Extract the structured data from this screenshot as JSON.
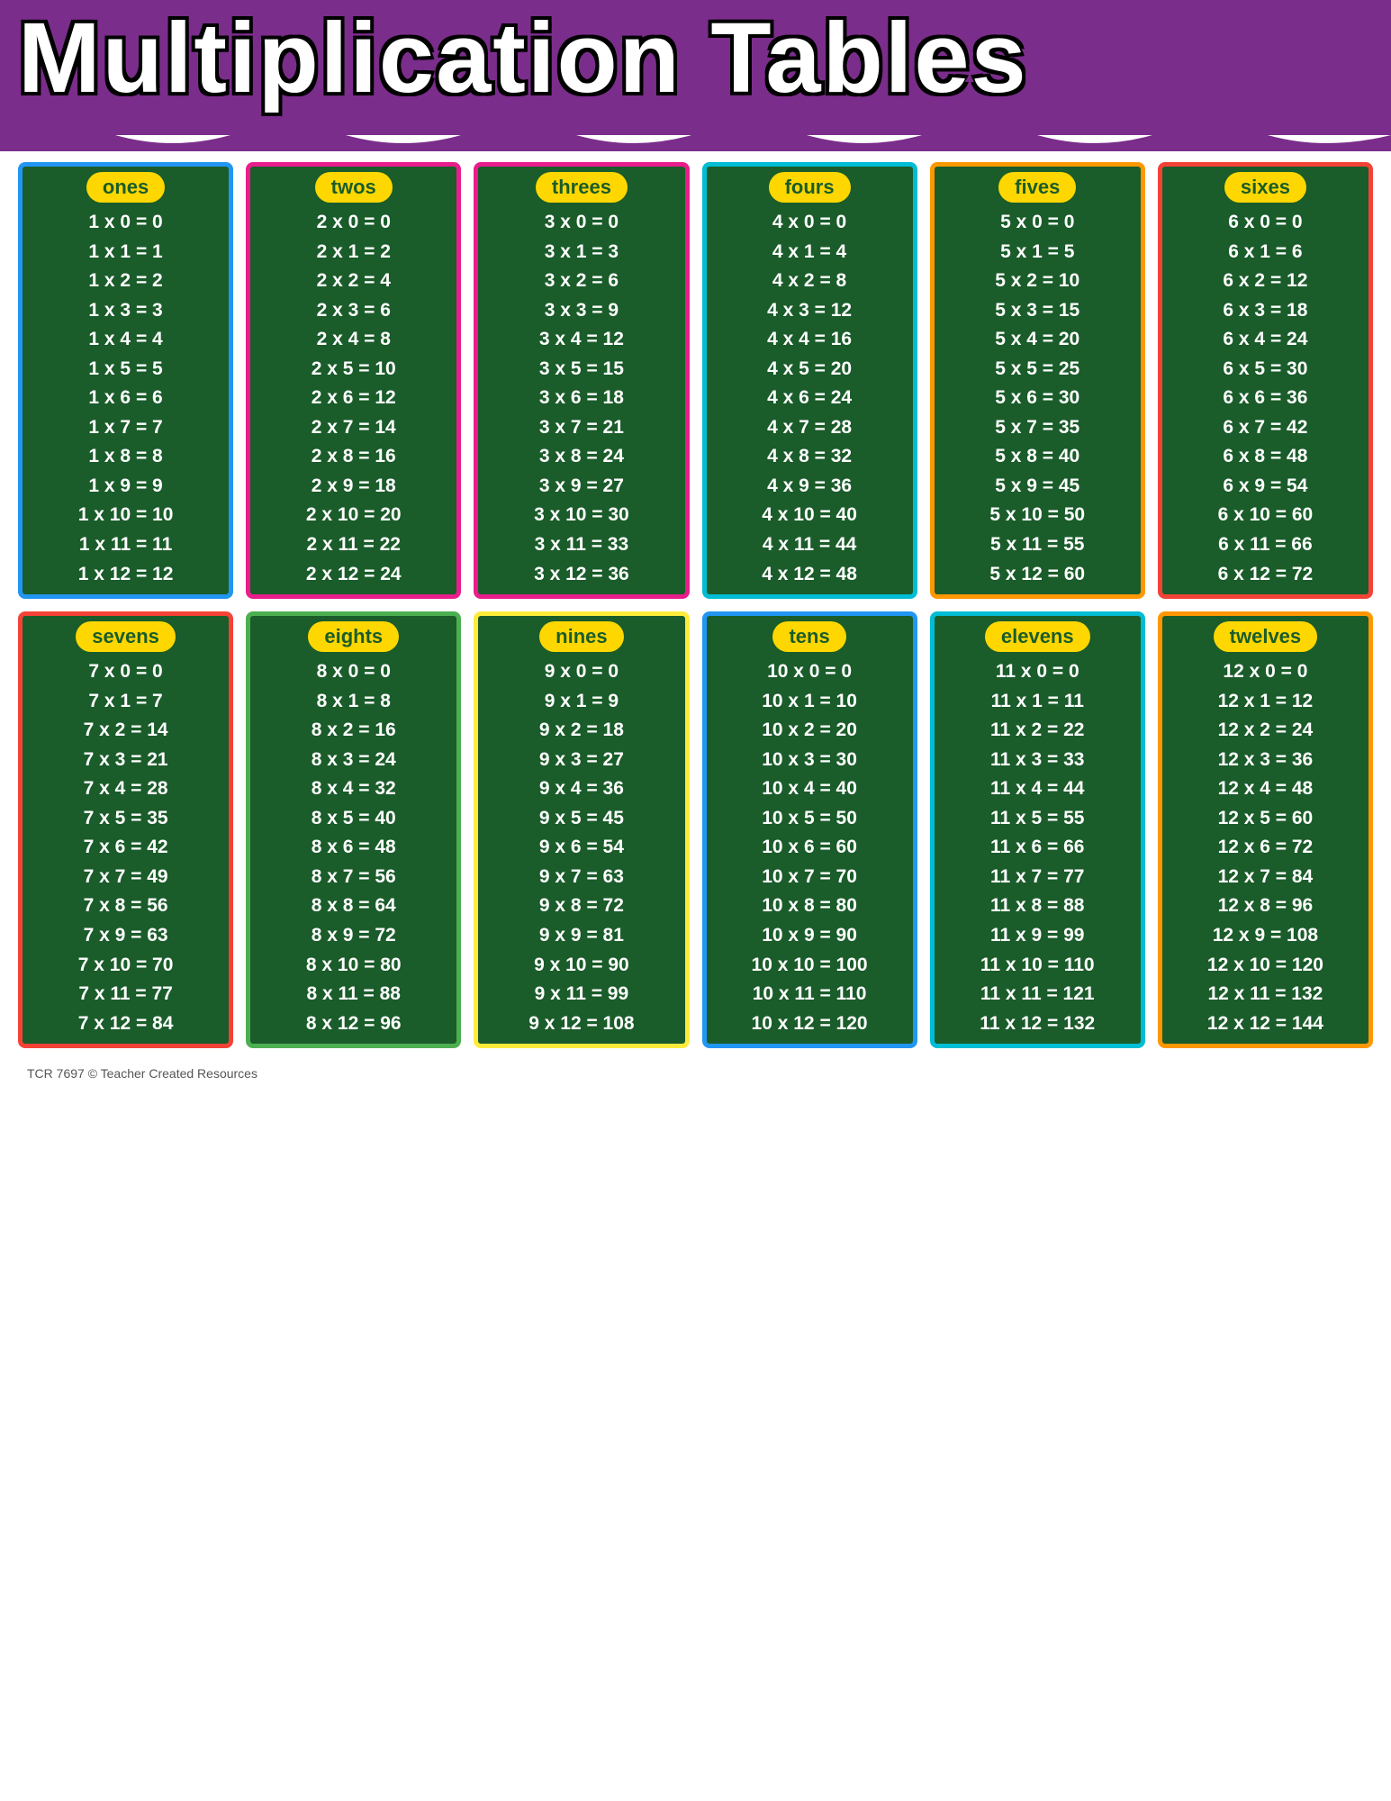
{
  "header": {
    "title": "Multiplication Tables",
    "bg_color": "#7B2D8B"
  },
  "footer": {
    "text": "TCR 7697 © Teacher Created Resources"
  },
  "tables": [
    {
      "id": "ones",
      "label": "ones",
      "border_color": "blue",
      "multiplier": 1,
      "rows": [
        "1 x 0 = 0",
        "1 x 1 = 1",
        "1 x 2 = 2",
        "1 x 3 = 3",
        "1 x 4 = 4",
        "1 x 5 = 5",
        "1 x 6 = 6",
        "1 x 7 = 7",
        "1 x 8 = 8",
        "1 x 9 = 9",
        "1 x 10 = 10",
        "1 x 11 = 11",
        "1 x 12 = 12"
      ]
    },
    {
      "id": "twos",
      "label": "twos",
      "border_color": "pink",
      "multiplier": 2,
      "rows": [
        "2 x 0 = 0",
        "2 x 1 = 2",
        "2 x 2 = 4",
        "2 x 3 = 6",
        "2 x 4 = 8",
        "2 x 5 = 10",
        "2 x 6 = 12",
        "2 x 7 = 14",
        "2 x 8 = 16",
        "2 x 9 = 18",
        "2 x 10 = 20",
        "2 x 11 = 22",
        "2 x 12 = 24"
      ]
    },
    {
      "id": "threes",
      "label": "threes",
      "border_color": "pink",
      "multiplier": 3,
      "rows": [
        "3 x 0 = 0",
        "3 x 1 = 3",
        "3 x 2 = 6",
        "3 x 3 = 9",
        "3 x 4 = 12",
        "3 x 5 = 15",
        "3 x 6 = 18",
        "3 x 7 = 21",
        "3 x 8 = 24",
        "3 x 9 = 27",
        "3 x 10 = 30",
        "3 x 11 = 33",
        "3 x 12 = 36"
      ]
    },
    {
      "id": "fours",
      "label": "fours",
      "border_color": "teal",
      "multiplier": 4,
      "rows": [
        "4 x 0 = 0",
        "4 x 1 = 4",
        "4 x 2 = 8",
        "4 x 3 = 12",
        "4 x 4 = 16",
        "4 x 5 = 20",
        "4 x 6 = 24",
        "4 x 7 = 28",
        "4 x 8 = 32",
        "4 x 9 = 36",
        "4 x 10 = 40",
        "4 x 11 = 44",
        "4 x 12 = 48"
      ]
    },
    {
      "id": "fives",
      "label": "fives",
      "border_color": "orange",
      "multiplier": 5,
      "rows": [
        "5 x 0 = 0",
        "5 x 1 = 5",
        "5 x 2 = 10",
        "5 x 3 = 15",
        "5 x 4 = 20",
        "5 x 5 = 25",
        "5 x 6 = 30",
        "5 x 7 = 35",
        "5 x 8 = 40",
        "5 x 9 = 45",
        "5 x 10 = 50",
        "5 x 11 = 55",
        "5 x 12 = 60"
      ]
    },
    {
      "id": "sixes",
      "label": "sixes",
      "border_color": "red",
      "multiplier": 6,
      "rows": [
        "6 x 0 = 0",
        "6 x 1 = 6",
        "6 x 2 = 12",
        "6 x 3 = 18",
        "6 x 4 = 24",
        "6 x 5 = 30",
        "6 x 6 = 36",
        "6 x 7 = 42",
        "6 x 8 = 48",
        "6 x 9 = 54",
        "6 x 10 = 60",
        "6 x 11 = 66",
        "6 x 12 = 72"
      ]
    },
    {
      "id": "sevens",
      "label": "sevens",
      "border_color": "red",
      "multiplier": 7,
      "rows": [
        "7 x 0 = 0",
        "7 x 1 = 7",
        "7 x 2 = 14",
        "7 x 3 = 21",
        "7 x 4 = 28",
        "7 x 5 = 35",
        "7 x 6 = 42",
        "7 x 7 = 49",
        "7 x 8 = 56",
        "7 x 9 = 63",
        "7 x 10 = 70",
        "7 x 11 = 77",
        "7 x 12 = 84"
      ]
    },
    {
      "id": "eights",
      "label": "eights",
      "border_color": "green",
      "multiplier": 8,
      "rows": [
        "8 x 0 = 0",
        "8 x 1 = 8",
        "8 x 2 = 16",
        "8 x 3 = 24",
        "8 x 4 = 32",
        "8 x 5 = 40",
        "8 x 6 = 48",
        "8 x 7 = 56",
        "8 x 8 = 64",
        "8 x 9 = 72",
        "8 x 10 = 80",
        "8 x 11 = 88",
        "8 x 12 = 96"
      ]
    },
    {
      "id": "nines",
      "label": "nines",
      "border_color": "yellow-border",
      "multiplier": 9,
      "rows": [
        "9 x 0 = 0",
        "9 x 1 = 9",
        "9 x 2 = 18",
        "9 x 3 = 27",
        "9 x 4 = 36",
        "9 x 5 = 45",
        "9 x 6 = 54",
        "9 x 7 = 63",
        "9 x 8 = 72",
        "9 x 9 = 81",
        "9 x 10 = 90",
        "9 x 11 = 99",
        "9 x 12 = 108"
      ]
    },
    {
      "id": "tens",
      "label": "tens",
      "border_color": "blue",
      "multiplier": 10,
      "rows": [
        "10 x 0 = 0",
        "10 x 1 = 10",
        "10 x 2 = 20",
        "10 x 3 = 30",
        "10 x 4 = 40",
        "10 x 5 = 50",
        "10 x 6 = 60",
        "10 x 7 = 70",
        "10 x 8 = 80",
        "10 x 9 = 90",
        "10 x 10 = 100",
        "10 x 11 = 110",
        "10 x 12 = 120"
      ]
    },
    {
      "id": "elevens",
      "label": "elevens",
      "border_color": "teal",
      "multiplier": 11,
      "rows": [
        "11 x 0 = 0",
        "11 x 1 = 11",
        "11 x 2 = 22",
        "11 x 3 = 33",
        "11 x 4 = 44",
        "11 x 5 = 55",
        "11 x 6 = 66",
        "11 x 7 = 77",
        "11 x 8 = 88",
        "11 x 9 = 99",
        "11 x 10 = 110",
        "11 x 11 = 121",
        "11 x 12 = 132"
      ]
    },
    {
      "id": "twelves",
      "label": "twelves",
      "border_color": "orange",
      "multiplier": 12,
      "rows": [
        "12 x 0 = 0",
        "12 x 1 = 12",
        "12 x 2 = 24",
        "12 x 3 = 36",
        "12 x 4 = 48",
        "12 x 5 = 60",
        "12 x 6 = 72",
        "12 x 7 = 84",
        "12 x 8 = 96",
        "12 x 9 = 108",
        "12 x 10 = 120",
        "12 x 11 = 132",
        "12 x 12 = 144"
      ]
    }
  ]
}
